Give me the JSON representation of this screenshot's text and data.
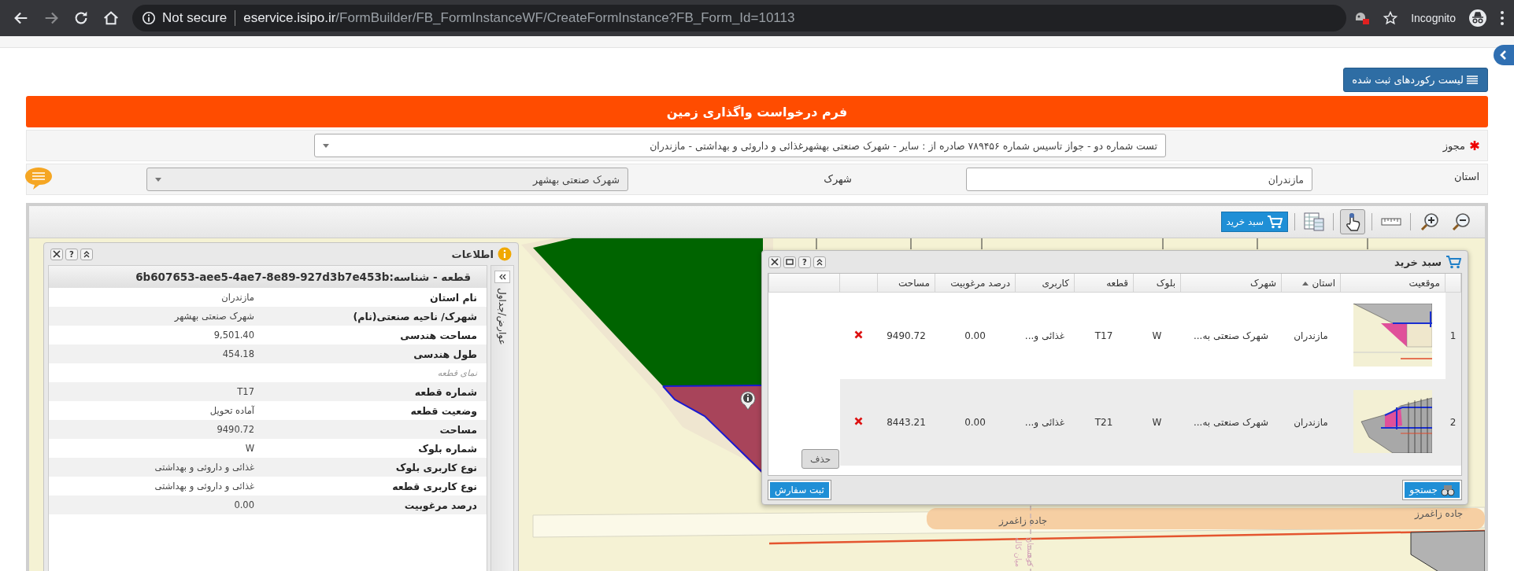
{
  "browser": {
    "nav": [
      {
        "kind": "back",
        "disabled": false
      },
      {
        "kind": "forward",
        "disabled": true
      },
      {
        "kind": "reload",
        "disabled": false
      },
      {
        "kind": "home",
        "disabled": false
      }
    ],
    "security": "Not secure",
    "domain": "eservice.isipo.ir",
    "path": "/FormBuilder/FB_FormInstanceWF/CreateFormInstance?FB_Form_Id=10113",
    "profile": "Incognito"
  },
  "records_button": "لیست رکوردهای ثبت شده",
  "form_title": "فرم درخواست واگذاری زمین",
  "license": {
    "label": "مجوز",
    "required": true,
    "value": "تست شماره دو - جواز تاسیس شماره ۷۸۹۴۵۶ صادره از : سایر - شهرک صنعتی بهشهرغذائی و داروئی و بهداشتی - مازندران"
  },
  "province": {
    "label": "استان",
    "value": "مازندران"
  },
  "town": {
    "label": "شهرک",
    "value": "شهرک صنعتی بهشهر",
    "disabled": true
  },
  "map": {
    "tools": [
      {
        "kind": "zoom-out",
        "selected": false
      },
      {
        "kind": "zoom-in",
        "selected": false
      },
      {
        "kind": "measure",
        "selected": false
      },
      {
        "kind": "pan",
        "selected": true
      },
      {
        "kind": "table",
        "selected": false
      }
    ],
    "basket_button": "سبد خرید",
    "road_labels": [
      "جاده زاغمرز",
      "جاده زاغمرز"
    ],
    "boundary_labels": [
      "میان کاله",
      "کوهستان"
    ]
  },
  "info_panel": {
    "title": "اطلاعات",
    "help": "?",
    "side_tab": "عوارض/جداول",
    "heading": "قطعه - شناسه:6b607653-aee5-4ae7-8e89-927d3b7e453b",
    "rows": [
      {
        "kind": "field",
        "label": "نام استان",
        "value": "مازندران"
      },
      {
        "kind": "field",
        "label": "شهرک/ ناحیه صنعتی(نام)",
        "value": "شهرک صنعتی بهشهر"
      },
      {
        "kind": "field",
        "label": "مساحت هندسی",
        "value": "9,501.40"
      },
      {
        "kind": "field",
        "label": "طول هندسی",
        "value": "454.18"
      },
      {
        "kind": "section",
        "label": "نمای قطعه"
      },
      {
        "kind": "field",
        "label": "شماره قطعه",
        "value": "T17"
      },
      {
        "kind": "field",
        "label": "وضعیت قطعه",
        "value": "آماده تحویل"
      },
      {
        "kind": "field",
        "label": "مساحت",
        "value": "9490.72"
      },
      {
        "kind": "field",
        "label": "شماره بلوک",
        "value": "W"
      },
      {
        "kind": "field",
        "label": "نوع کاربری بلوک",
        "value": "غذائی و داروئی و بهداشتی"
      },
      {
        "kind": "field",
        "label": "نوع کاربری قطعه",
        "value": "غذائی و داروئی و بهداشتی"
      },
      {
        "kind": "field",
        "label": "درصد مرغوبیت",
        "value": "0.00"
      }
    ]
  },
  "basket": {
    "title": "سبد خرید",
    "help": "?",
    "columns": [
      {
        "label": "موقعیت",
        "sorted": false
      },
      {
        "label": "استان",
        "sorted": true
      },
      {
        "label": "شهرک",
        "sorted": false
      },
      {
        "label": "بلوک",
        "sorted": false
      },
      {
        "label": "قطعه",
        "sorted": false
      },
      {
        "label": "کاربری",
        "sorted": false
      },
      {
        "label": "درصد مرغوبیت",
        "sorted": false
      },
      {
        "label": "مساحت",
        "sorted": false
      }
    ],
    "rows": [
      {
        "number": "1",
        "province": "مازندران",
        "town": "شهرک صنعتی به...",
        "block": "W",
        "parcel": "T17",
        "use": "غذائی و...",
        "quality": "0.00",
        "area": "9490.72",
        "selected": false
      },
      {
        "number": "2",
        "province": "مازندران",
        "town": "شهرک صنعتی به...",
        "block": "W",
        "parcel": "T21",
        "use": "غذائی و...",
        "quality": "0.00",
        "area": "8443.21",
        "selected": true
      }
    ],
    "delete_button": "حذف",
    "search_button": "جستجو",
    "order_button": "ثبت سفارش"
  }
}
